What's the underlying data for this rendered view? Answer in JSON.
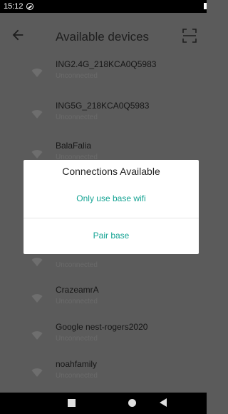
{
  "status_bar": {
    "time": "15:12"
  },
  "app_bar": {
    "title": "Available devices"
  },
  "devices": [
    {
      "name": "ING2.4G_218KCA0Q5983",
      "status": "Unconnected"
    },
    {
      "name": "ING5G_218KCA0Q5983",
      "status": "Unconnected"
    },
    {
      "name": "BalaFalia",
      "status": "Unconnected"
    },
    {
      "name": "",
      "status": ""
    },
    {
      "name": "",
      "status": "Unconnected"
    },
    {
      "name": "CrazeamrA",
      "status": "Unconnected"
    },
    {
      "name": "Google nest-rogers2020",
      "status": "Unconnected"
    },
    {
      "name": "noahfamily",
      "status": "Unconnected"
    }
  ],
  "dialog": {
    "title": "Connections Available",
    "options": [
      "Only use base wifi",
      "Pair base"
    ]
  },
  "colors": {
    "accent": "#16a494",
    "scrim": "#5b5b5b",
    "dialog": "#ffffff"
  },
  "icons": [
    "do-not-disturb-icon",
    "back-arrow-icon",
    "scan-icon",
    "wifi-icon",
    "recent-apps-icon",
    "home-icon",
    "nav-back-icon"
  ]
}
